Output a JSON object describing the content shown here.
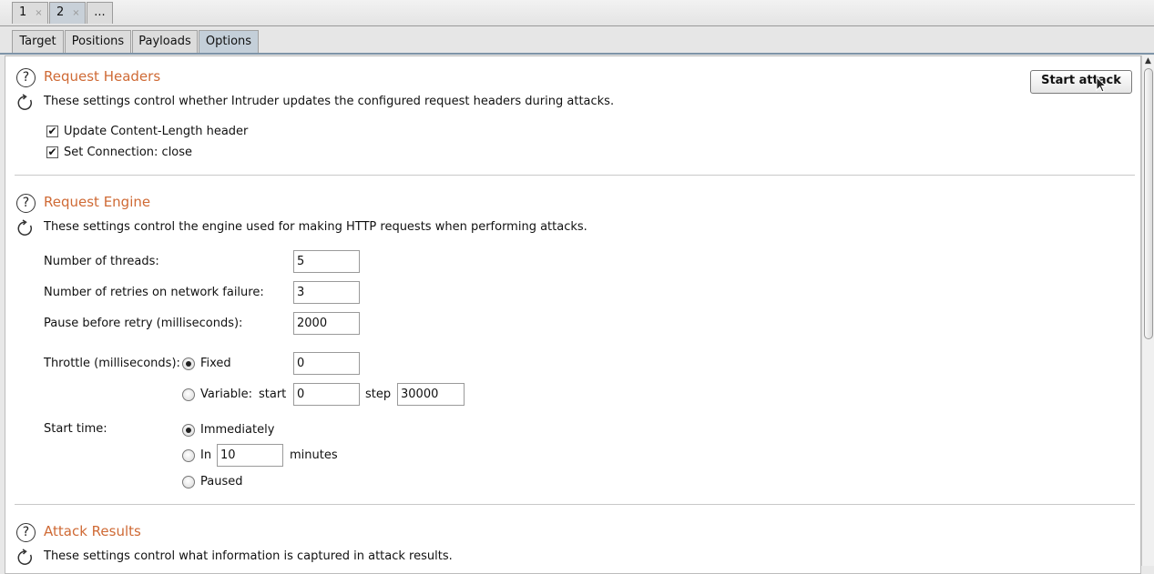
{
  "top_tabs": [
    {
      "label": "1",
      "close": "×"
    },
    {
      "label": "2",
      "close": "×"
    },
    {
      "label": "..."
    }
  ],
  "sub_tabs": [
    "Target",
    "Positions",
    "Payloads",
    "Options"
  ],
  "active_sub_tab": "Options",
  "start_attack_label": "Start attack",
  "request_headers": {
    "title": "Request Headers",
    "description": "These settings control whether Intruder updates the configured request headers during attacks.",
    "options": [
      {
        "label": "Update Content-Length header",
        "checked": true
      },
      {
        "label": "Set Connection: close",
        "checked": true
      }
    ]
  },
  "request_engine": {
    "title": "Request Engine",
    "description": "These settings control the engine used for making HTTP requests when performing attacks.",
    "threads_label": "Number of threads:",
    "threads_value": "5",
    "retries_label": "Number of retries on network failure:",
    "retries_value": "3",
    "pause_label": "Pause before retry (milliseconds):",
    "pause_value": "2000",
    "throttle_label": "Throttle (milliseconds):",
    "throttle_fixed_label": "Fixed",
    "throttle_fixed_value": "0",
    "throttle_variable_label": "Variable:",
    "throttle_start_label": "start",
    "throttle_start_value": "0",
    "throttle_step_label": "step",
    "throttle_step_value": "30000",
    "start_time_label": "Start time:",
    "start_immediately_label": "Immediately",
    "start_in_label": "In",
    "start_in_value": "10",
    "start_in_unit": "minutes",
    "start_paused_label": "Paused",
    "throttle_mode": "Fixed",
    "start_mode": "Immediately"
  },
  "attack_results": {
    "title": "Attack Results",
    "description": "These settings control what information is captured in attack results."
  },
  "colors": {
    "section_title": "#cf6a35",
    "active_tab": "#c4cfd9"
  }
}
